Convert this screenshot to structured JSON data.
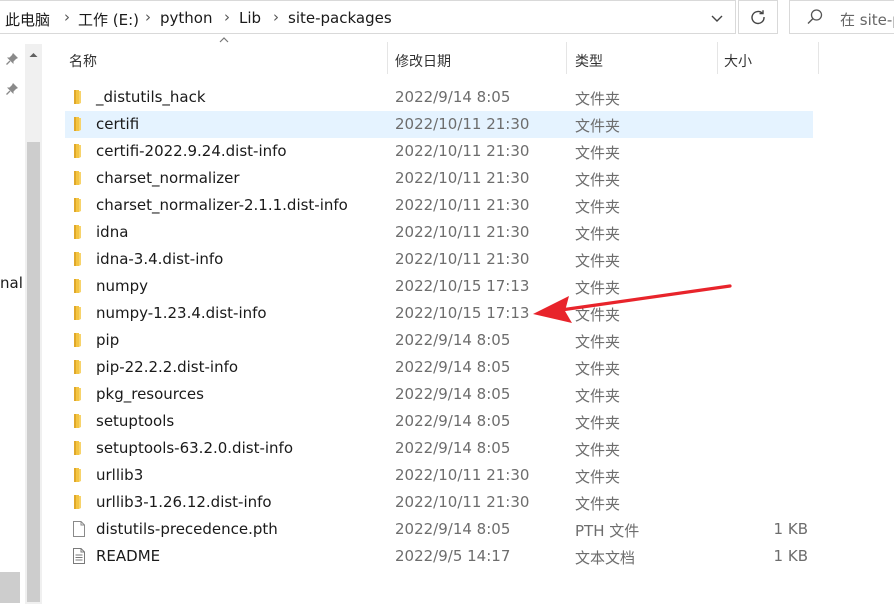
{
  "breadcrumb": {
    "items": [
      "此电脑",
      "工作 (E:)",
      "python",
      "Lib",
      "site-packages"
    ]
  },
  "search": {
    "placeholder": "在 site-p"
  },
  "nav": {
    "partial_label": "nal"
  },
  "columns": {
    "name": "名称",
    "date": "修改日期",
    "type": "类型",
    "size": "大小"
  },
  "files": [
    {
      "name": "_distutils_hack",
      "date": "2022/9/14 8:05",
      "type": "文件夹",
      "size": "",
      "icon": "folder-icon"
    },
    {
      "name": "certifi",
      "date": "2022/10/11 21:30",
      "type": "文件夹",
      "size": "",
      "icon": "folder-icon",
      "selected": true
    },
    {
      "name": "certifi-2022.9.24.dist-info",
      "date": "2022/10/11 21:30",
      "type": "文件夹",
      "size": "",
      "icon": "folder-icon"
    },
    {
      "name": "charset_normalizer",
      "date": "2022/10/11 21:30",
      "type": "文件夹",
      "size": "",
      "icon": "folder-icon"
    },
    {
      "name": "charset_normalizer-2.1.1.dist-info",
      "date": "2022/10/11 21:30",
      "type": "文件夹",
      "size": "",
      "icon": "folder-icon"
    },
    {
      "name": "idna",
      "date": "2022/10/11 21:30",
      "type": "文件夹",
      "size": "",
      "icon": "folder-icon"
    },
    {
      "name": "idna-3.4.dist-info",
      "date": "2022/10/11 21:30",
      "type": "文件夹",
      "size": "",
      "icon": "folder-icon"
    },
    {
      "name": "numpy",
      "date": "2022/10/15 17:13",
      "type": "文件夹",
      "size": "",
      "icon": "folder-icon"
    },
    {
      "name": "numpy-1.23.4.dist-info",
      "date": "2022/10/15 17:13",
      "type": "文件夹",
      "size": "",
      "icon": "folder-icon"
    },
    {
      "name": "pip",
      "date": "2022/9/14 8:05",
      "type": "文件夹",
      "size": "",
      "icon": "folder-icon"
    },
    {
      "name": "pip-22.2.2.dist-info",
      "date": "2022/9/14 8:05",
      "type": "文件夹",
      "size": "",
      "icon": "folder-icon"
    },
    {
      "name": "pkg_resources",
      "date": "2022/9/14 8:05",
      "type": "文件夹",
      "size": "",
      "icon": "folder-icon"
    },
    {
      "name": "setuptools",
      "date": "2022/9/14 8:05",
      "type": "文件夹",
      "size": "",
      "icon": "folder-icon"
    },
    {
      "name": "setuptools-63.2.0.dist-info",
      "date": "2022/9/14 8:05",
      "type": "文件夹",
      "size": "",
      "icon": "folder-icon"
    },
    {
      "name": "urllib3",
      "date": "2022/10/11 21:30",
      "type": "文件夹",
      "size": "",
      "icon": "folder-icon"
    },
    {
      "name": "urllib3-1.26.12.dist-info",
      "date": "2022/10/11 21:30",
      "type": "文件夹",
      "size": "",
      "icon": "folder-icon"
    },
    {
      "name": "distutils-precedence.pth",
      "date": "2022/9/14 8:05",
      "type": "PTH 文件",
      "size": "1 KB",
      "icon": "file-icon"
    },
    {
      "name": "README",
      "date": "2022/9/5 14:17",
      "type": "文本文档",
      "size": "1 KB",
      "icon": "text-file-icon"
    }
  ],
  "colors": {
    "folder": "#f4c542",
    "selection": "#e5f3ff",
    "annotation_arrow": "#e8242b"
  }
}
